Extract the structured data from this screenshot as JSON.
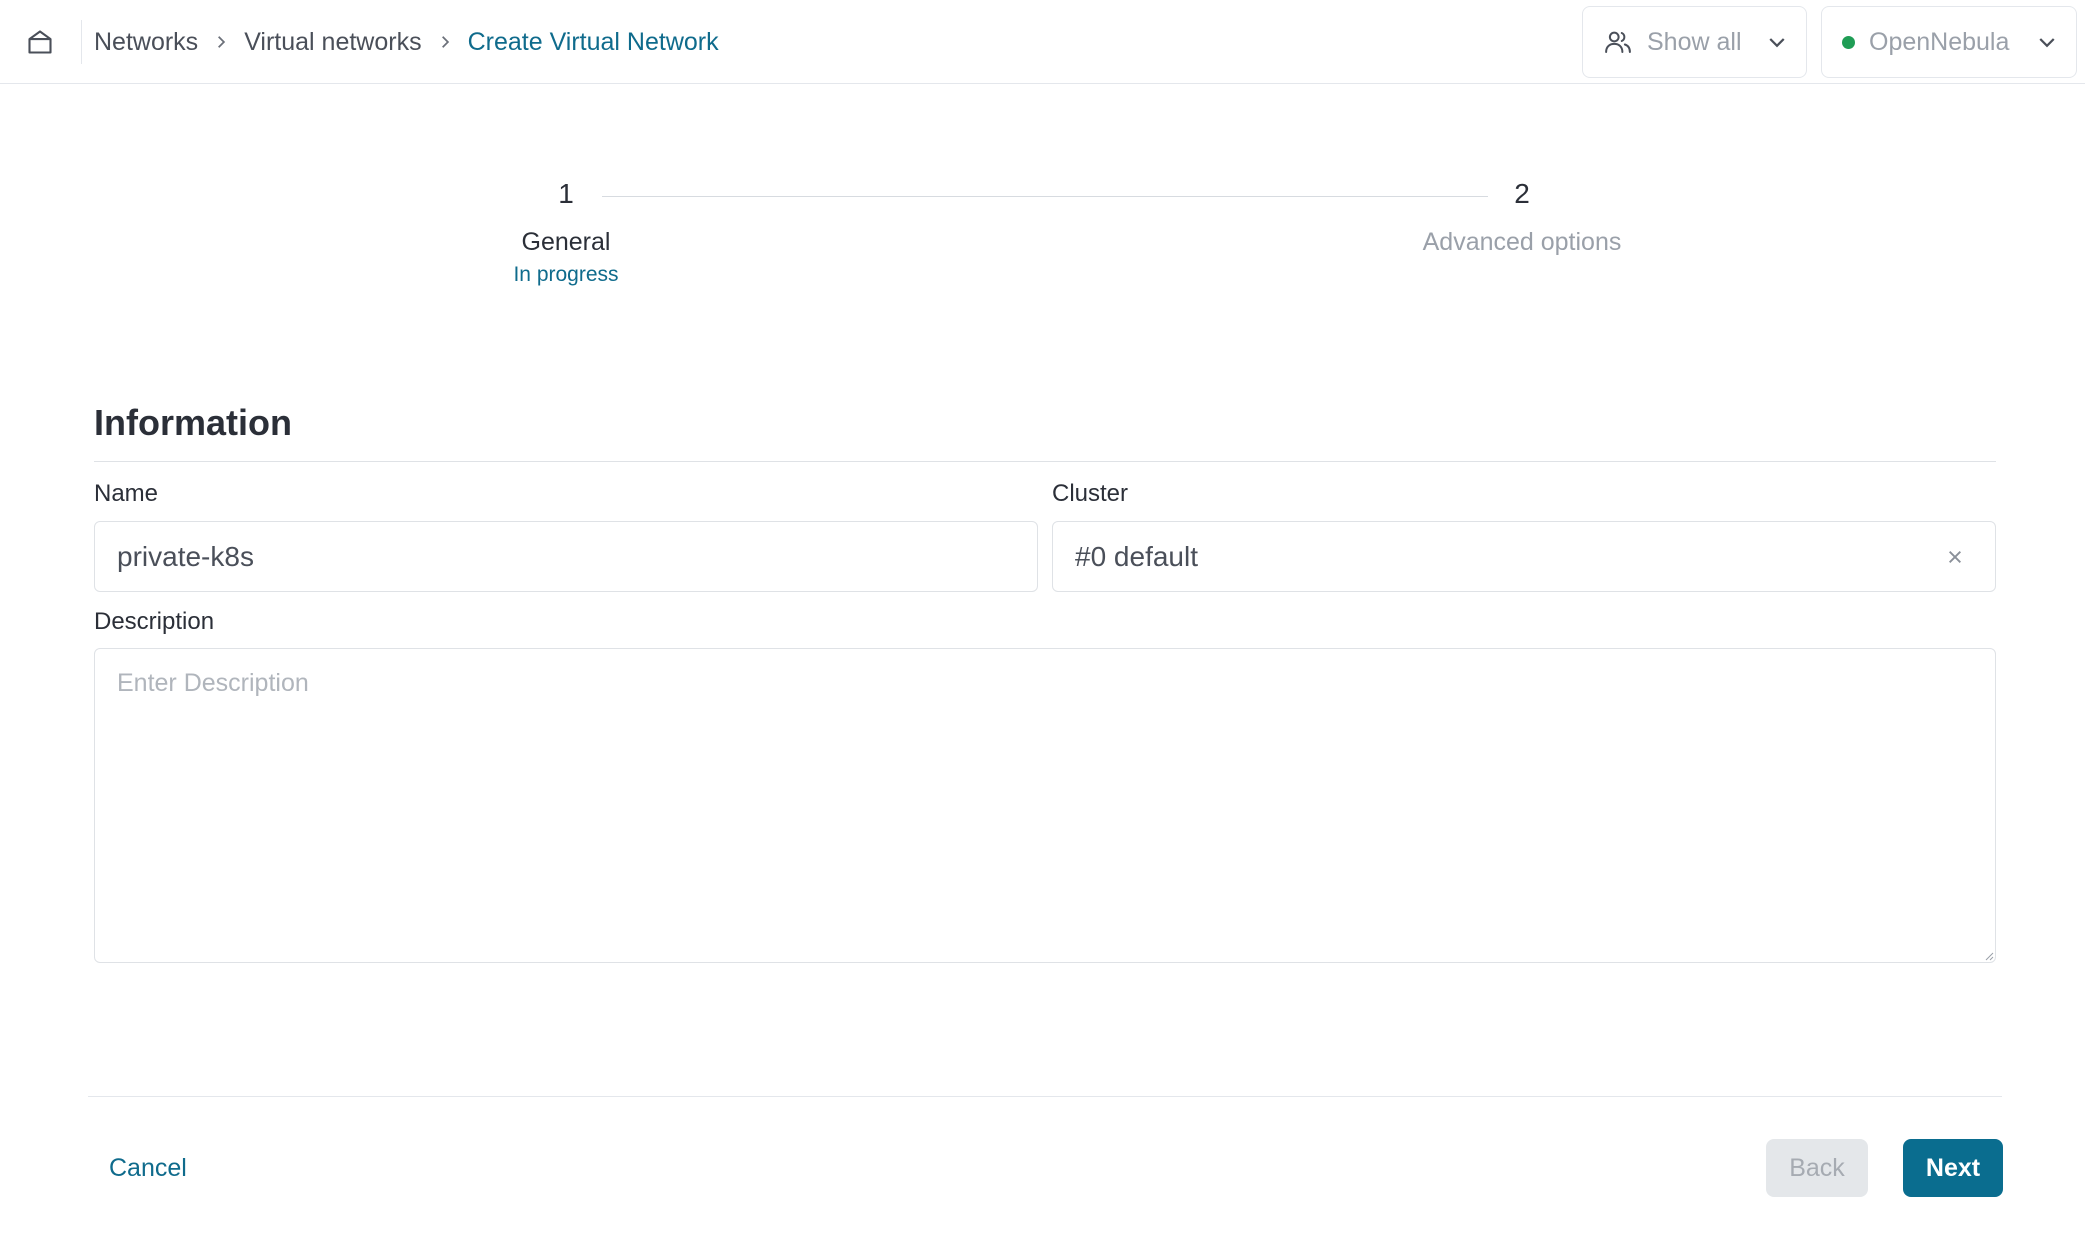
{
  "colors": {
    "accent": "#0f6b8c",
    "primary_button": "#0a6d8f",
    "status_dot": "#1f9d55",
    "muted_text": "#9aa0a9"
  },
  "topbar": {
    "breadcrumb": [
      {
        "label": "Networks"
      },
      {
        "label": "Virtual networks"
      },
      {
        "label": "Create Virtual Network"
      }
    ],
    "group_filter": {
      "label": "Show all",
      "icon": "users-icon"
    },
    "zone_filter": {
      "label": "OpenNebula",
      "status": "online"
    }
  },
  "stepper": {
    "steps": [
      {
        "number": "1",
        "title": "General",
        "status": "In progress",
        "active": true
      },
      {
        "number": "2",
        "title": "Advanced options",
        "status": "",
        "active": false
      }
    ]
  },
  "form": {
    "section_title": "Information",
    "name": {
      "label": "Name",
      "value": "private-k8s"
    },
    "cluster": {
      "label": "Cluster",
      "value": "#0 default"
    },
    "description": {
      "label": "Description",
      "value": "",
      "placeholder": "Enter Description"
    }
  },
  "footer": {
    "cancel_label": "Cancel",
    "back_label": "Back",
    "next_label": "Next",
    "back_disabled": true
  }
}
